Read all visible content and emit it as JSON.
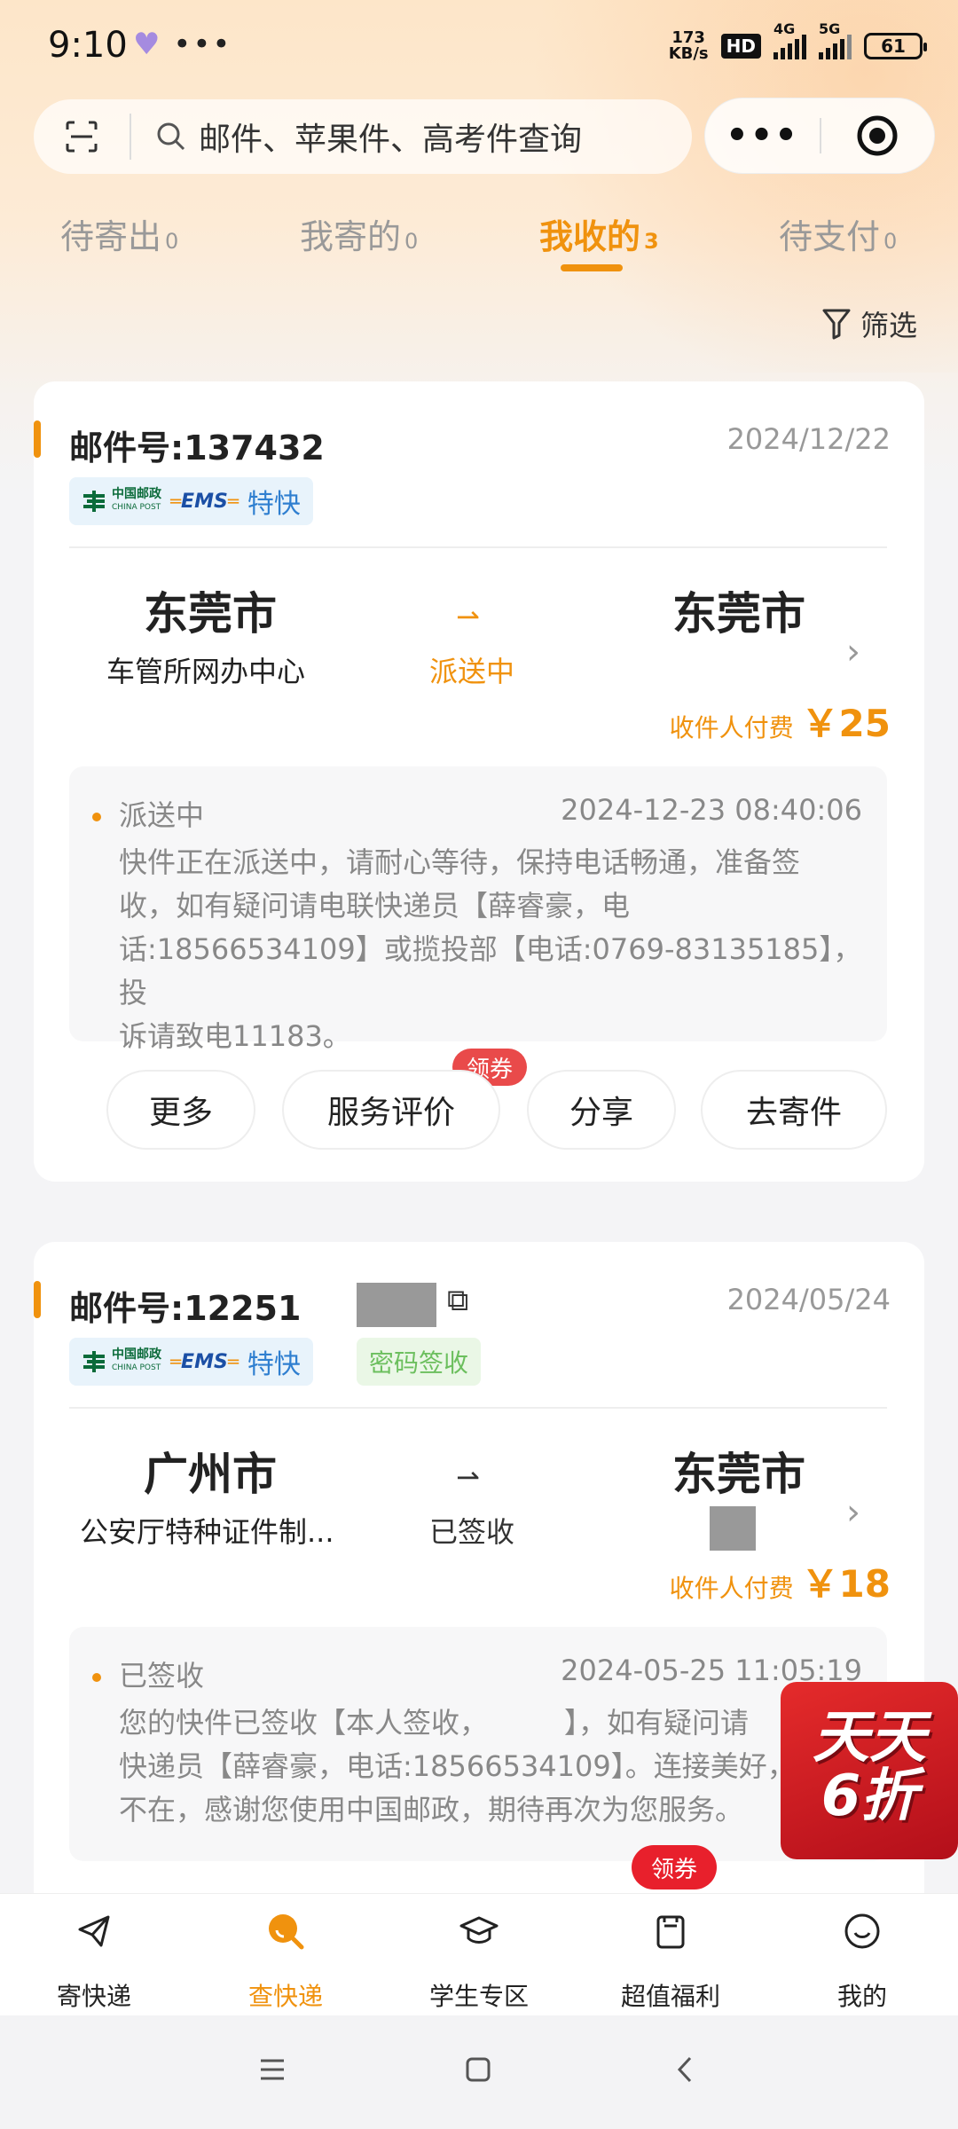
{
  "status_bar": {
    "time": "9:10",
    "net_speed_value": "173",
    "net_speed_unit": "KB/s",
    "hd": "HD",
    "net_4g": "4G",
    "net_5g": "5G",
    "battery": "61"
  },
  "search": {
    "placeholder": "邮件、苹果件、高考件查询"
  },
  "capsule": {
    "more": "•••"
  },
  "tabs": [
    {
      "label": "待寄出",
      "count": "0"
    },
    {
      "label": "我寄的",
      "count": "0"
    },
    {
      "label": "我收的",
      "count": "3"
    },
    {
      "label": "待支付",
      "count": "0"
    }
  ],
  "filter_label": "筛选",
  "parcels": [
    {
      "mail_no": "邮件号:137432",
      "date": "2024/12/22",
      "badge_cp_cn": "中国邮政",
      "badge_cp_en": "CHINA POST",
      "badge_ems": "EMS",
      "badge_service": "特快",
      "from_city": "东莞市",
      "from_addr": "车管所网办中心",
      "status": "派送中",
      "to_city": "东莞市",
      "pay_label": "收件人付费",
      "pay_amount": "￥25",
      "track_status": "派送中",
      "track_time": "2024-12-23 08:40:06",
      "track_lines": [
        "快件正在派送中，请耐心等待，保持电话畅通，准备签",
        "收，如有疑问请电联快递员【薛睿豪，电",
        "话:18566534109】或揽投部【电话:0769-83135185】，投",
        "诉请致电11183。"
      ],
      "buttons": [
        "更多",
        "服务评价",
        "分享",
        "去寄件"
      ],
      "coupon_label": "领券"
    },
    {
      "mail_no": "邮件号:12251",
      "date": "2024/05/24",
      "badge_cp_cn": "中国邮政",
      "badge_cp_en": "CHINA POST",
      "badge_ems": "EMS",
      "badge_service": "特快",
      "badge_extra": "密码签收",
      "from_city": "广州市",
      "from_addr": "公安厅特种证件制...",
      "status": "已签收",
      "to_city": "东莞市",
      "pay_label": "收件人付费",
      "pay_amount": "￥18",
      "track_status": "已签收",
      "track_time": "2024-05-25 11:05:19",
      "track_lines": [
        "您的快件已签收【本人签收，",
        "】，如有疑问请",
        "快递员【薛睿豪，电话:18566534109】。连接美好，",
        "不在，感谢您使用中国邮政，期待再次为您服务。"
      ]
    }
  ],
  "promo": {
    "line1": "天天",
    "line2": "6折"
  },
  "bottom_nav": [
    {
      "label": "寄快递"
    },
    {
      "label": "查快递"
    },
    {
      "label": "学生专区"
    },
    {
      "label": "超值福利"
    },
    {
      "label": "我的"
    }
  ],
  "nav_coupon": "领券",
  "colors": {
    "accent": "#f0920e",
    "coupon_red": "#e8202c"
  }
}
